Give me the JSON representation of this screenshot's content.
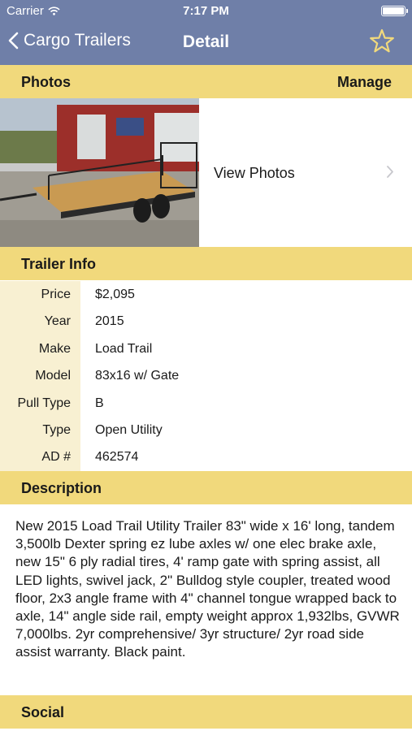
{
  "status_bar": {
    "carrier": "Carrier",
    "time": "7:17 PM"
  },
  "nav": {
    "back_label": "Cargo Trailers",
    "title": "Detail"
  },
  "photos": {
    "header": "Photos",
    "manage_label": "Manage",
    "view_label": "View Photos"
  },
  "trailer_info": {
    "header": "Trailer Info",
    "rows": [
      {
        "label": "Price",
        "value": "$2,095"
      },
      {
        "label": "Year",
        "value": "2015"
      },
      {
        "label": "Make",
        "value": "Load Trail"
      },
      {
        "label": "Model",
        "value": "83x16 w/ Gate"
      },
      {
        "label": "Pull Type",
        "value": "B"
      },
      {
        "label": "Type",
        "value": "Open Utility"
      },
      {
        "label": "AD #",
        "value": "462574"
      }
    ]
  },
  "description": {
    "header": "Description",
    "text": "New 2015 Load Trail Utility Trailer 83\" wide x 16' long, tandem 3,500lb Dexter spring ez lube axles w/ one elec brake axle, new 15\" 6 ply radial tires, 4' ramp gate with spring assist, all LED lights, swivel jack, 2\" Bulldog style coupler, treated wood floor, 2x3 angle frame with 4\" channel tongue wrapped back to axle, 14\" angle side rail, empty weight approx 1,932lbs, GVWR 7,000lbs. 2yr comprehensive/ 3yr structure/ 2yr road side assist warranty. Black paint."
  },
  "social": {
    "header": "Social"
  },
  "colors": {
    "nav": "#6f7fa8",
    "section_header": "#f1d97c",
    "label_column": "#f8f0d2",
    "star": "#f1d97c"
  },
  "icons": {
    "back": "chevron-left-icon",
    "favorite": "star-outline-icon",
    "disclosure": "chevron-right-icon",
    "wifi": "wifi-icon",
    "battery": "battery-icon"
  }
}
